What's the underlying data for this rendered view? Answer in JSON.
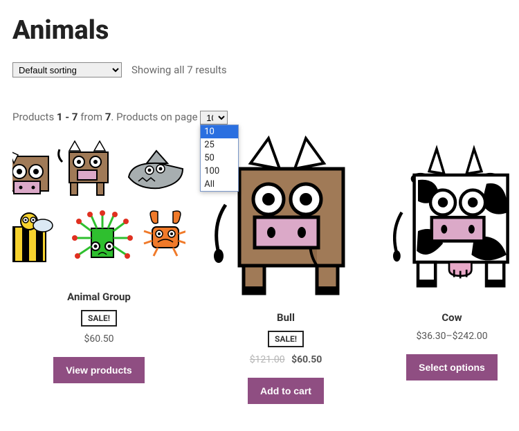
{
  "page_title": "Animals",
  "sort": {
    "selected": "Default sorting",
    "options": [
      "Default sorting"
    ]
  },
  "results_text": "Showing all 7 results",
  "pager": {
    "prefix": "Products ",
    "range": "1 - 7",
    "mid": " from ",
    "total": "7",
    "suffix": ". Products on page ",
    "selected": "10",
    "options": [
      "10",
      "25",
      "50",
      "100",
      "All"
    ]
  },
  "products": [
    {
      "name": "Animal Group",
      "sale": true,
      "sale_label": "SALE!",
      "price": "$60.50",
      "button": "View products"
    },
    {
      "name": "Bull",
      "sale": true,
      "sale_label": "SALE!",
      "old_price": "$121.00",
      "price": "$60.50",
      "button": "Add to cart"
    },
    {
      "name": "Cow",
      "sale": false,
      "price": "$36.30–$242.00",
      "button": "Select options"
    }
  ]
}
